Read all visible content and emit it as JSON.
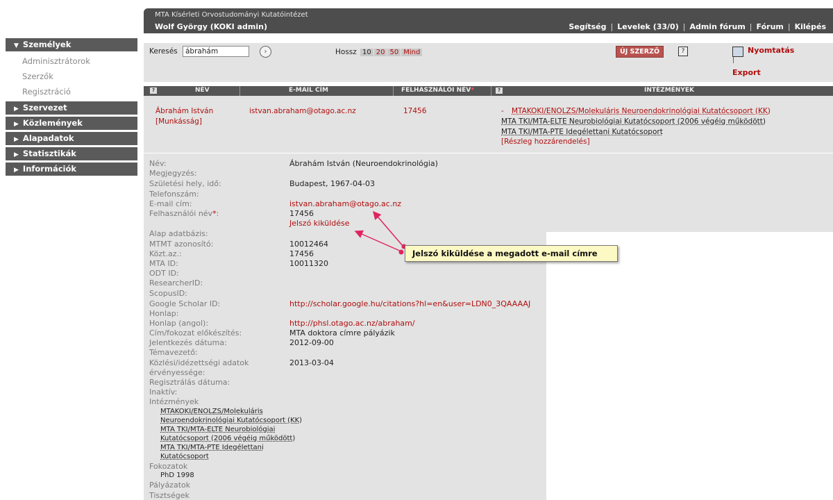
{
  "header": {
    "org": "MTA Kísérleti Orvostudományi Kutatóintézet",
    "user": "Wolf György (KOKI admin)",
    "links": [
      "Segítség",
      "Levelek (33/0)",
      "Admin fórum",
      "Fórum",
      "Kilépés"
    ]
  },
  "sidebar": {
    "szemelyek": "Személyek",
    "sub": [
      "Adminisztrátorok",
      "Szerzők",
      "Regisztráció"
    ],
    "sections": [
      "Szervezet",
      "Közlemények",
      "Alapadatok",
      "Statisztikák",
      "Információk"
    ]
  },
  "toolbar": {
    "search_label": "Keresés",
    "search_value": "ábrahám",
    "length_label": "Hossz",
    "lengths": [
      "10",
      "20",
      "50",
      "Mind"
    ],
    "new_author": "ÚJ SZERZŐ",
    "print": "Nyomtatás",
    "export": "Export"
  },
  "table": {
    "cols": [
      "NÉV",
      "E-MAIL CÍM",
      "FELHASZNÁLÓI NÉV",
      "INTÉZMÉNYEK"
    ],
    "required_star": "*",
    "row": {
      "name": "Ábrahám István",
      "munkassag": "[Munkásság]",
      "email": "istvan.abraham@otago.ac.nz",
      "username": "17456",
      "inst_dash": "-",
      "institutions": [
        "MTAKOKI/ENOLZS/Molekuláris Neuroendokrinológiai Kutatócsoport (KK)",
        "MTA TKI/MTA-ELTE Neurobiológiai Kutatócsoport (2006 végéig működött)",
        "MTA TKI/MTA-PTE Idegélettani Kutatócsoport"
      ],
      "assign": "[Részleg hozzárendelés]"
    }
  },
  "details": {
    "labels": {
      "nev": "Név:",
      "megjegyzes": "Megjegyzés:",
      "szuletesi": "Születési hely, idő:",
      "telefon": "Telefonszám:",
      "email": "E-mail cím:",
      "felhasznalo": "Felhasználói név",
      "alap": "Alap adatbázis:",
      "mtmt": "MTMT azonosító:",
      "kozt": "Közt.az.:",
      "mtaid": "MTA ID:",
      "odt": "ODT ID:",
      "researcher": "ResearcherID:",
      "scopus": "ScopusID:",
      "scholar": "Google Scholar ID:",
      "honlap": "Honlap:",
      "honlap_en": "Honlap (angol):",
      "cim": "Cím/fokozat előkészítés:",
      "jelentkezes": "Jelentkezés dátuma:",
      "temavezeto": "Témavezető:",
      "kozlesi1": "Közlési/idézettségi adatok",
      "kozlesi2": "érvényessége:",
      "regisztralas": "Regisztrálás dátuma:",
      "inaktiv": "Inaktív:",
      "intezmenyek": "Intézmények",
      "fokozatok": "Fokozatok",
      "palyazatok": "Pályázatok",
      "tisztsegek": "Tisztségek"
    },
    "values": {
      "nev": "Ábrahám István (Neuroendokrinológia)",
      "szuletesi": "Budapest, 1967-04-03",
      "email": "istvan.abraham@otago.ac.nz",
      "felhasznalo": "17456",
      "jelszo": "Jelszó kiküldése",
      "mtmt": "10012464",
      "kozt": "17456",
      "mtaid": "10011320",
      "scholar": "http://scholar.google.hu/citations?hl=en&user=LDN0_3QAAAAJ",
      "honlap_en": "http://phsl.otago.ac.nz/abraham/",
      "cim": "MTA doktora címre pályázik",
      "jelentkezes": "2012-09-00",
      "kozlesi": "2013-03-04"
    },
    "institutions": [
      "MTAKOKI/ENOLZS/Molekuláris",
      "Neuroendokrinológiai Kutatócsoport (KK)",
      "MTA TKI/MTA-ELTE Neurobiológiai",
      "Kutatócsoport (2006 végéig működött)",
      "MTA TKI/MTA-PTE Idegélettani",
      "Kutatócsoport"
    ],
    "degree": "PhD  1998"
  },
  "callout": "Jelszó kiküldése a megadott e-mail címre",
  "colors": {
    "accent_red": "#b00d0d",
    "header_bg": "#4d4d4d",
    "panel_bg": "#e3e3e3",
    "callout_bg": "#fdf9c4"
  }
}
